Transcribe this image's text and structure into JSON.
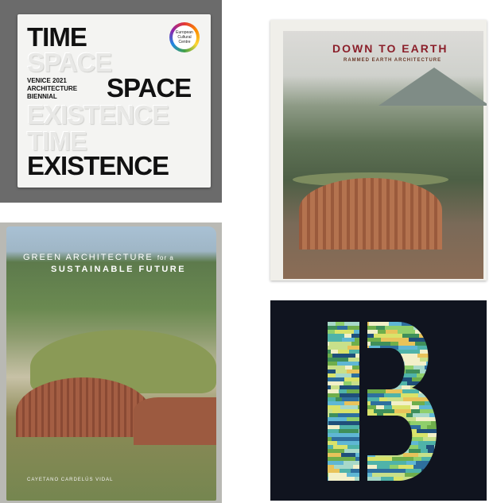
{
  "books": [
    {
      "lines": [
        "TIME",
        "SPACE",
        "SPACE",
        "EXISTENCE",
        "TIME",
        "EXISTENCE"
      ],
      "subtitle": "VENICE 2021\nARCHITECTURE\nBIENNIAL",
      "logo_text": "European\nCultural\nCentre"
    },
    {
      "title": "DOWN TO EARTH",
      "subtitle": "RAMMED EARTH ARCHITECTURE"
    },
    {
      "title_part1": "GREEN ARCHITECTURE",
      "title_part1_small": "for a",
      "title_part2": "SUSTAINABLE FUTURE",
      "author": "CAYETANO CARDELÚS VIDAL"
    },
    {
      "letter": "B",
      "stripe_colors": [
        "#2e6f9e",
        "#4fb3a9",
        "#8fcf6b",
        "#d9e36a",
        "#f2f0c9",
        "#3f8f5a",
        "#a7d9c9",
        "#1f4f7a",
        "#c8e08a",
        "#5fb7d4",
        "#e8c35a",
        "#6fae4b"
      ]
    }
  ]
}
